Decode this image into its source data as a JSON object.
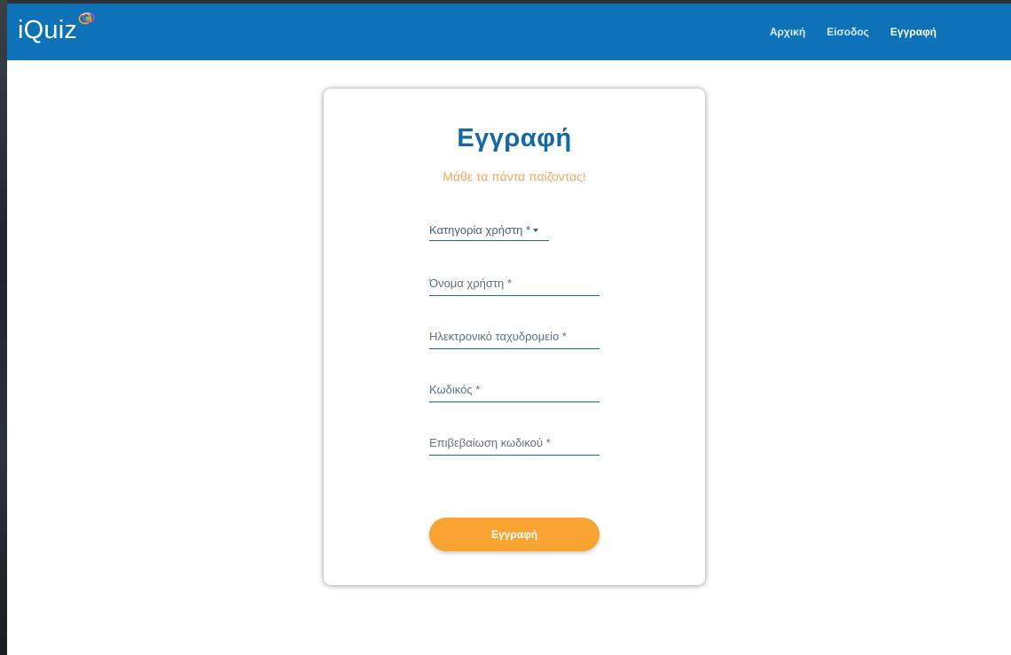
{
  "header": {
    "brand": "iQuiz",
    "nav": [
      {
        "label": "Αρχική"
      },
      {
        "label": "Είσοδος"
      },
      {
        "label": "Εγγραφή"
      }
    ]
  },
  "form": {
    "title": "Εγγραφή",
    "subtitle": "Μάθε τα πάντα παίζοντας!",
    "user_category_label": "Κατηγορία χρήστη *",
    "username_placeholder": "Όνομα χρήστη *",
    "email_placeholder": "Ηλεκτρονικό ταχυδρομείο *",
    "password_placeholder": "Κωδικός *",
    "confirm_password_placeholder": "Επιβεβαίωση κωδικού *",
    "submit_label": "Εγγραφή"
  },
  "colors": {
    "navbar": "#0e72b8",
    "title": "#1568a8",
    "subtitle": "#f0a862",
    "button": "#f9a430"
  },
  "icons": {
    "logo": "brain-logo-icon",
    "select_caret": "caret-down-icon"
  }
}
